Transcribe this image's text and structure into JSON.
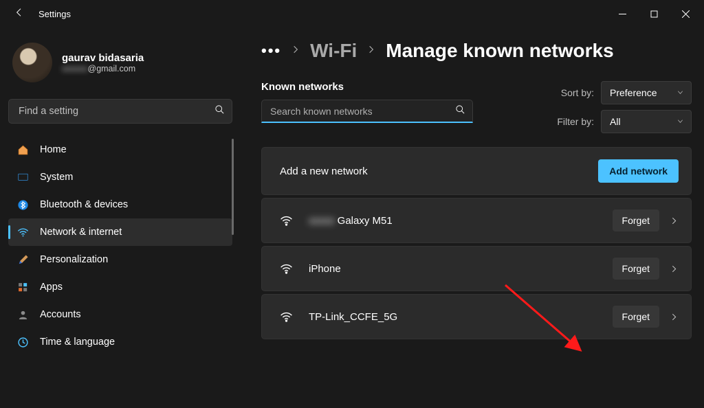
{
  "window": {
    "title": "Settings"
  },
  "profile": {
    "name": "gaurav bidasaria",
    "email_hidden": "xxxxxx",
    "email_domain": "@gmail.com"
  },
  "sidebar": {
    "search_placeholder": "Find a setting",
    "items": [
      {
        "label": "Home"
      },
      {
        "label": "System"
      },
      {
        "label": "Bluetooth & devices"
      },
      {
        "label": "Network & internet"
      },
      {
        "label": "Personalization"
      },
      {
        "label": "Apps"
      },
      {
        "label": "Accounts"
      },
      {
        "label": "Time & language"
      }
    ],
    "active_index": 3
  },
  "breadcrumbs": {
    "overflow": "•••",
    "items": [
      "Wi-Fi",
      "Manage known networks"
    ]
  },
  "known_networks": {
    "section_label": "Known networks",
    "search_placeholder": "Search known networks",
    "sort_label": "Sort by:",
    "filter_label": "Filter by:",
    "sort_value": "Preference",
    "filter_value": "All",
    "add_label": "Add a new network",
    "add_button": "Add network",
    "forget_label": "Forget",
    "networks": [
      {
        "name_hidden": "xxxxx",
        "name": "Galaxy M51"
      },
      {
        "name_hidden": "",
        "name": "iPhone"
      },
      {
        "name_hidden": "",
        "name": "TP-Link_CCFE_5G"
      }
    ]
  }
}
